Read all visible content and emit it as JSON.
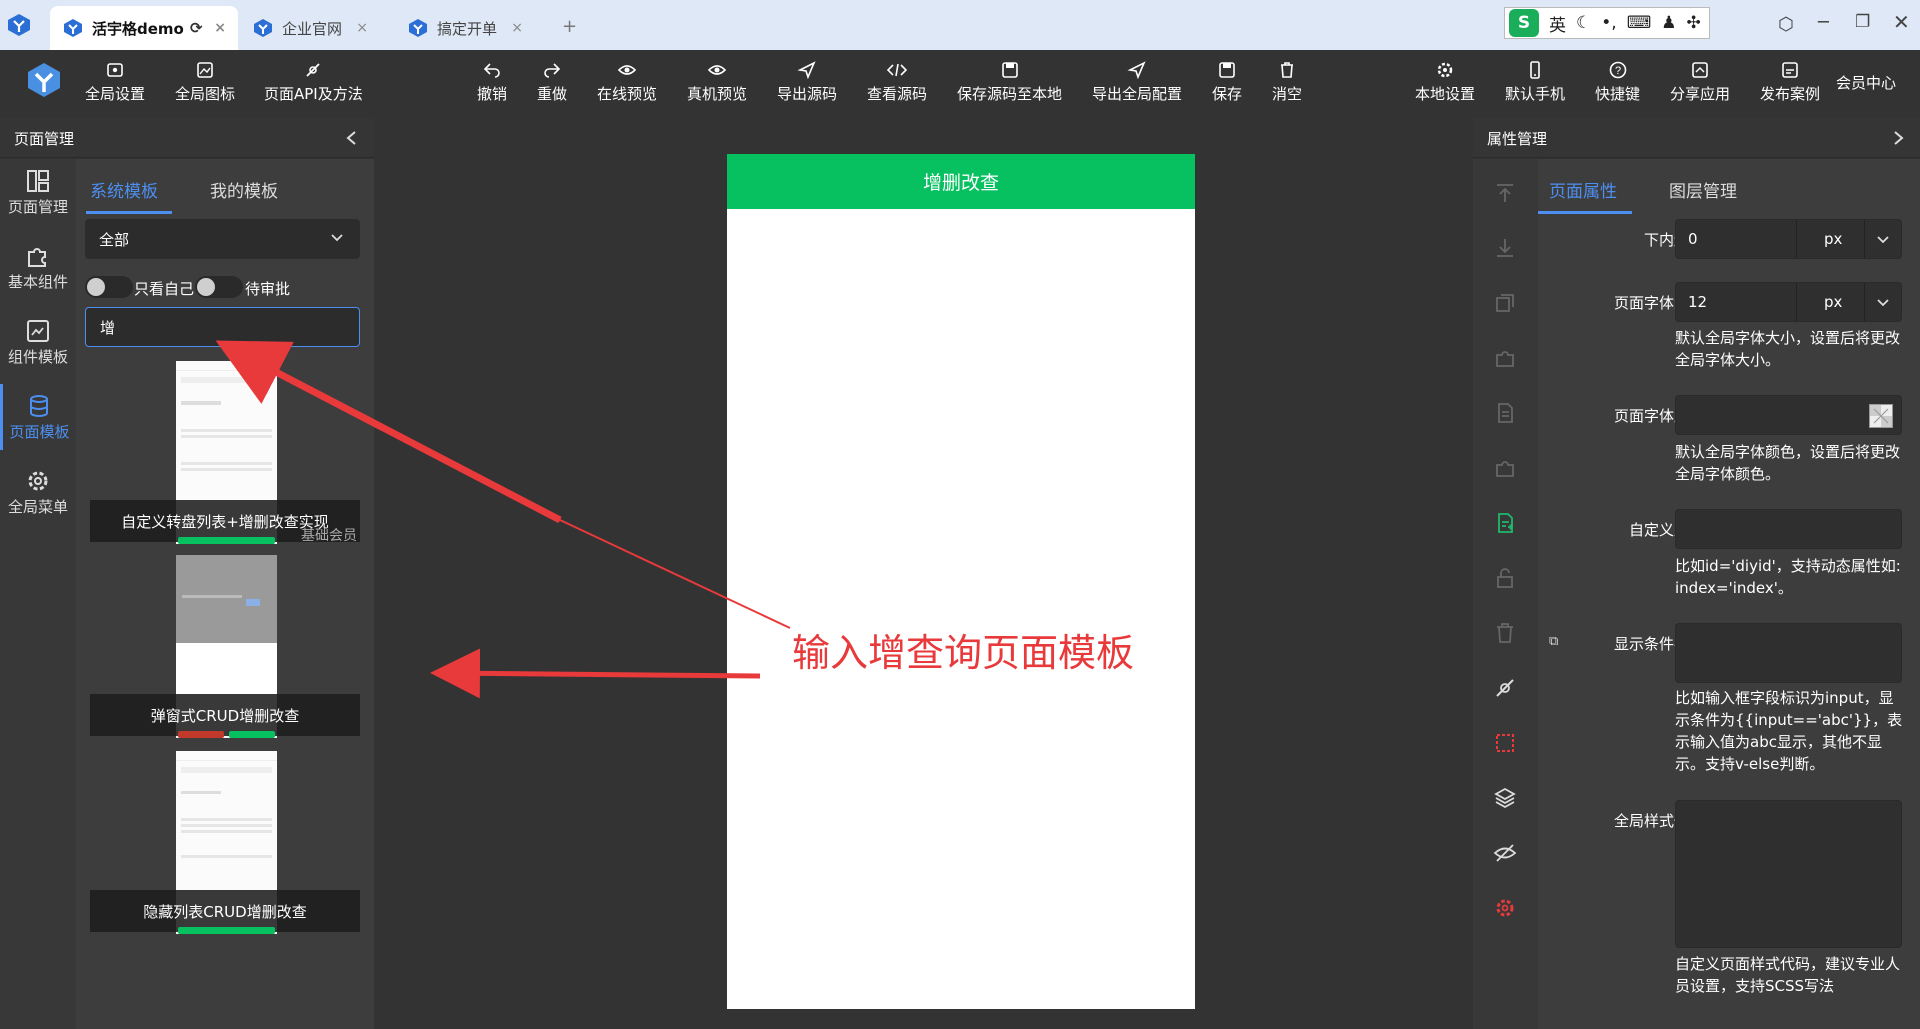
{
  "tabs": [
    {
      "label": "活宇格demo",
      "active": true
    },
    {
      "label": "企业官网",
      "active": false
    },
    {
      "label": "搞定开单",
      "active": false
    }
  ],
  "tabbar": {
    "close": "×",
    "add": "+",
    "ime_label": "英"
  },
  "toolbar": {
    "left": [
      "全局设置",
      "全局图标",
      "页面API及方法"
    ],
    "center": [
      "撤销",
      "重做",
      "在线预览",
      "真机预览",
      "导出源码",
      "查看源码",
      "保存源码至本地",
      "导出全局配置",
      "保存",
      "消空"
    ],
    "right": [
      "本地设置",
      "默认手机",
      "快捷键",
      "分享应用",
      "发布案例"
    ],
    "member": "会员中心"
  },
  "left": {
    "header": "页面管理",
    "nav": [
      "页面管理",
      "基本组件",
      "组件模板",
      "页面模板",
      "全局菜单"
    ],
    "active_nav": 3,
    "tabs": [
      "系统模板",
      "我的模板"
    ],
    "filter_value": "全部",
    "toggle_self": "只看自己",
    "toggle_pending": "待审批",
    "search_value": "增",
    "templates": [
      {
        "label": "自定义转盘列表+增删改查实现",
        "badge": "基础会员"
      },
      {
        "label": "弹窗式CRUD增删改查",
        "badge": ""
      },
      {
        "label": "隐藏列表CRUD增删改查",
        "badge": ""
      }
    ]
  },
  "canvas": {
    "page_title": "增删改查",
    "annotation": "输入增查询页面模板",
    "accent": "#07c160",
    "arrow_color": "#e8393b"
  },
  "right": {
    "header": "属性管理",
    "tabs": [
      "页面属性",
      "图层管理"
    ],
    "fields": {
      "bottom_padding": {
        "label": "下内边距",
        "value": "0",
        "unit": "px"
      },
      "font_size": {
        "label": "页面字体大小",
        "value": "12",
        "unit": "px",
        "note": "默认全局字体大小，设置后将更改全局字体大小。"
      },
      "font_color": {
        "label": "页面字体颜色",
        "note": "默认全局字体颜色，设置后将更改全局字体颜色。"
      },
      "custom_attr": {
        "label": "自定义属性",
        "note": "比如id='diyid'，支持动态属性如: index='index'。"
      },
      "condition": {
        "label": "显示条件判断",
        "note": "比如输入框字段标识为input，显示条件为{{input=='abc'}}，表示输入值为abc显示，其他不显示。支持v-else判断。"
      },
      "style_code": {
        "label": "全局样式代码",
        "note": "自定义页面样式代码，建议专业人员设置，支持SCSS写法"
      }
    }
  }
}
